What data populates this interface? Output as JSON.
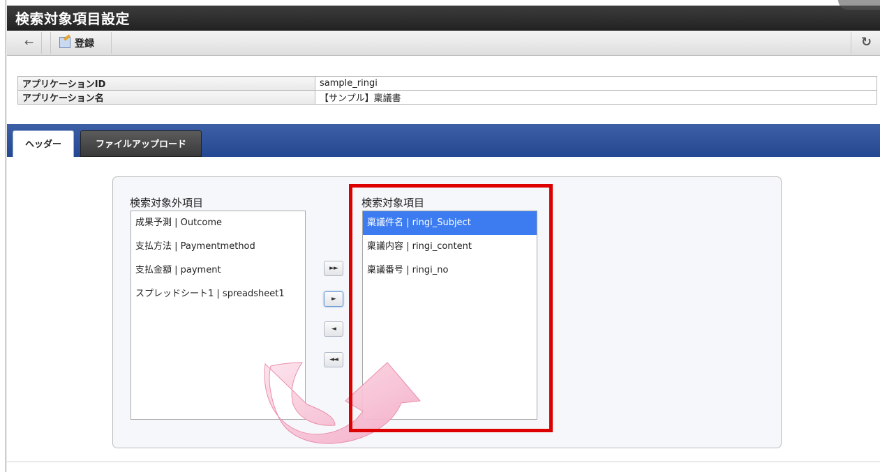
{
  "window": {
    "title": "検索対象項目設定"
  },
  "toolbar": {
    "back_icon": "back-arrow-icon",
    "register_label": "登録",
    "register_icon": "edit-form-icon",
    "refresh_icon": "refresh-icon"
  },
  "info": {
    "rows": [
      {
        "label": "アプリケーションID",
        "value": "sample_ringi"
      },
      {
        "label": "アプリケーション名",
        "value": "【サンプル】稟議書"
      }
    ]
  },
  "tabs": [
    {
      "label": "ヘッダー",
      "active": true
    },
    {
      "label": "ファイルアップロード",
      "active": false
    }
  ],
  "excluded": {
    "title": "検索対象外項目",
    "items": [
      "成果予測 | Outcome",
      "支払方法 | Paymentmethod",
      "支払金額 | payment",
      "スプレッドシート1 | spreadsheet1"
    ]
  },
  "included": {
    "title": "検索対象項目",
    "selected_index": 0,
    "items": [
      "稟議件名 | ringi_Subject",
      "稟議内容 | ringi_content",
      "稟議番号 | ringi_no"
    ]
  },
  "move_buttons": {
    "add_all": "►►",
    "add": "►",
    "remove": "◄",
    "remove_all": "◄◄"
  },
  "colors": {
    "title_bar": "#2b2b2b",
    "tab_strip": "#2f529b",
    "selected_item": "#3c7cf0",
    "highlight": "#dd0000",
    "arrow": "#f5b8cf"
  }
}
